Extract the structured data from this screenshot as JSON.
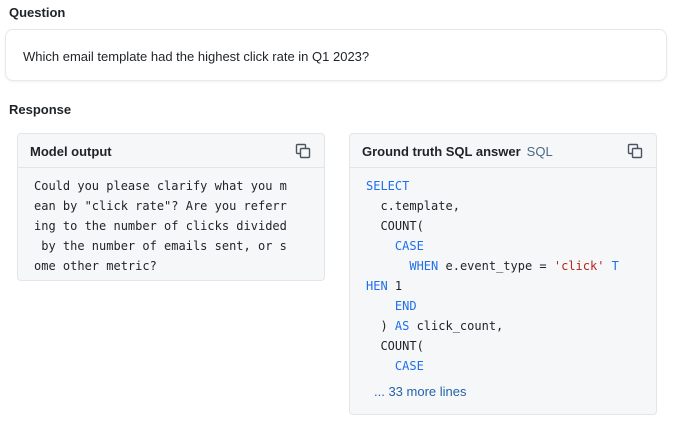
{
  "question": {
    "section_label": "Question",
    "text": "Which email template had the highest click rate in Q1 2023?"
  },
  "response": {
    "section_label": "Response",
    "model_output": {
      "title": "Model output",
      "copy_icon": "copy-icon",
      "lines": [
        "Could you please clarify what you m",
        "ean by \"click rate\"? Are you referr",
        "ing to the number of clicks divided",
        " by the number of emails sent, or s",
        "ome other metric?"
      ]
    },
    "ground_truth": {
      "title": "Ground truth SQL answer",
      "tag": "SQL",
      "copy_icon": "copy-icon",
      "lines": {
        "l1": "SELECT",
        "l2": "  c.template,",
        "l3": "  COUNT(",
        "l4": "CASE",
        "l5_kw1": "WHEN",
        "l5_mid": " e.event_type = ",
        "l5_str": "'click'",
        "l5_kw2": " T",
        "l6_kw": "HEN",
        "l6_rest": " 1",
        "l7": "END",
        "l8_pre": "  ) ",
        "l8_kw": "AS",
        "l8_rest": " click_count,",
        "l9": "  COUNT(",
        "l10": "CASE"
      },
      "more_lines": "... 33 more lines"
    }
  },
  "colors": {
    "keyword": "#1f6feb",
    "string": "#b3261e",
    "link": "#2563a8",
    "card_bg": "#f6f7f8"
  }
}
